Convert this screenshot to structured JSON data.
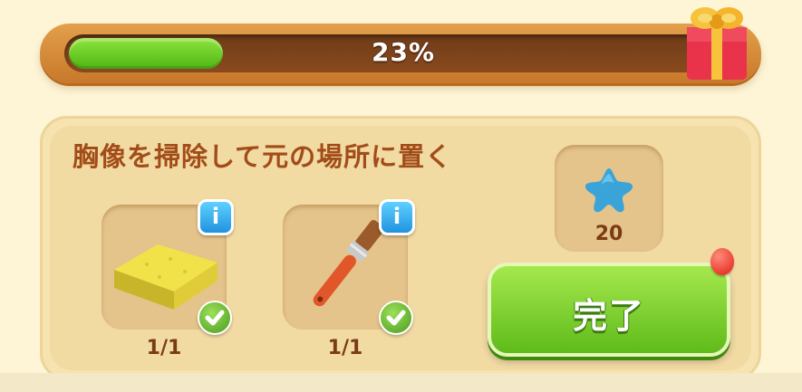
{
  "progress": {
    "label": "23%",
    "value": 0.23
  },
  "task": {
    "title": "胸像を掃除して元の場所に置く",
    "tools": [
      {
        "name": "sponge",
        "count": "1/1",
        "icon": "sponge-icon"
      },
      {
        "name": "paintbrush",
        "count": "1/1",
        "icon": "paintbrush-icon"
      }
    ],
    "info_label": "i"
  },
  "reward": {
    "icon": "blue-star-icon",
    "amount": "20"
  },
  "complete_button": {
    "label": "完了"
  },
  "colors": {
    "accent": "#5fbb1a",
    "title": "#a24d19",
    "track": "#8a4a1e"
  }
}
